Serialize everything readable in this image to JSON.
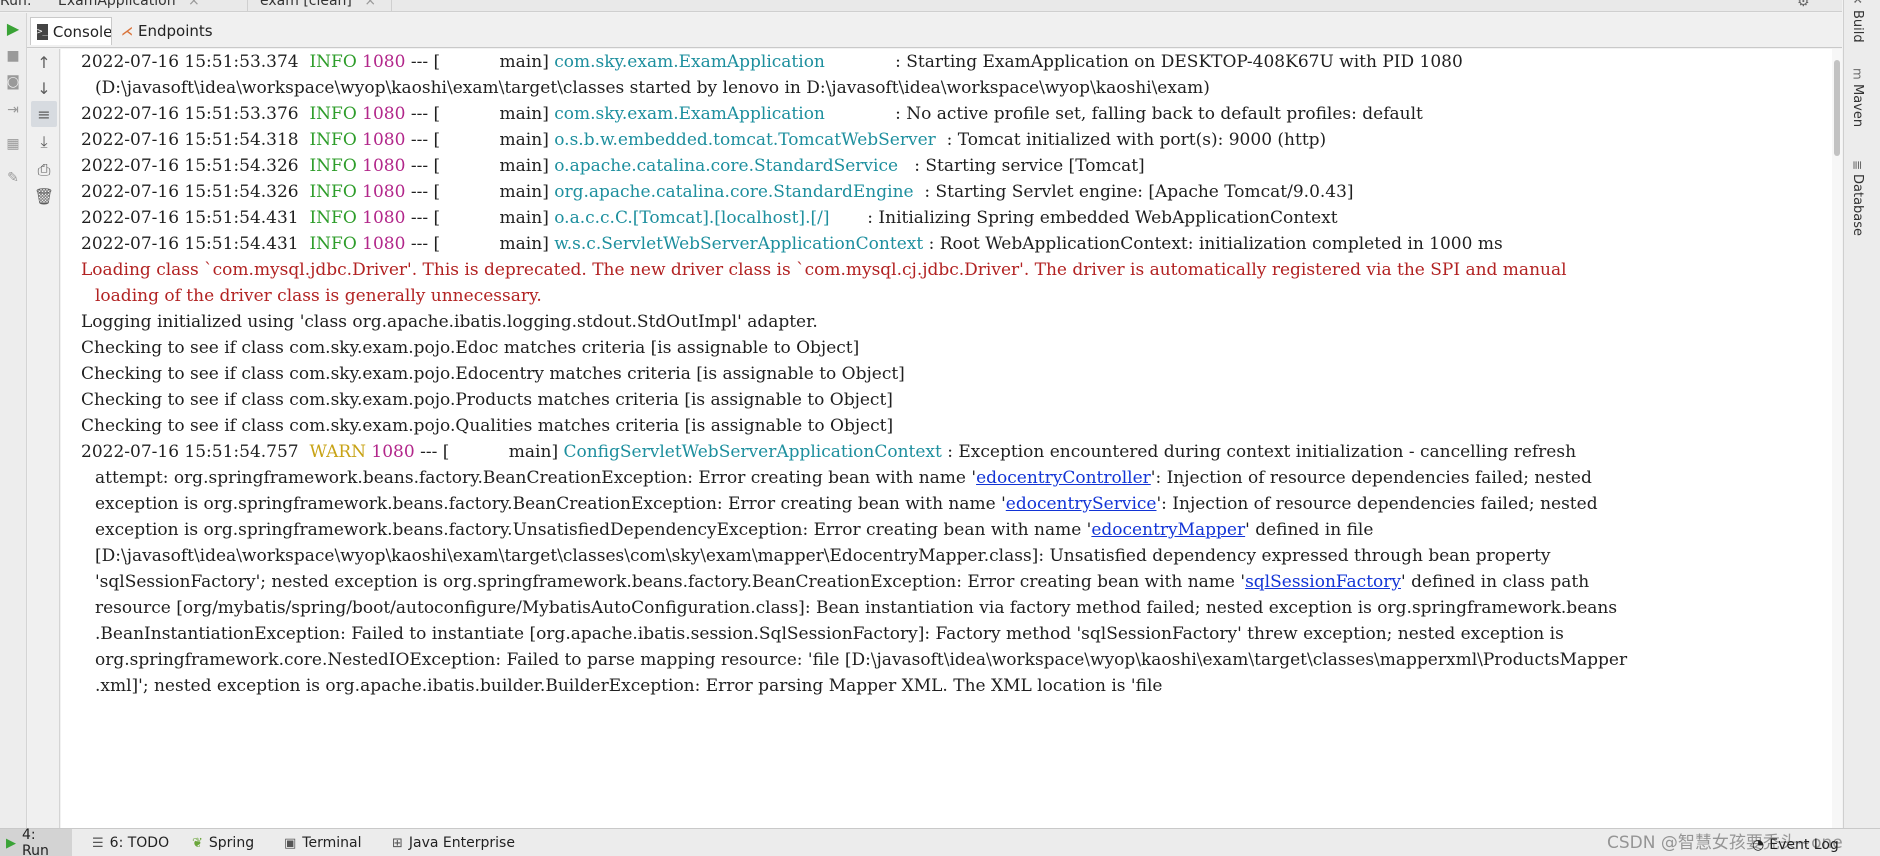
{
  "tool_window": {
    "run_label": "Run:",
    "tabs": [
      {
        "label": "ExamApplication"
      },
      {
        "label": "exam [clean]"
      }
    ],
    "close_glyph": "×"
  },
  "console_tabs": [
    {
      "label": "Console",
      "icon": "console-icon"
    },
    {
      "label": "Endpoints",
      "icon": "endpoints-icon"
    }
  ],
  "log": {
    "lines": [
      {
        "ts": "2022-07-16 15:51:53.374",
        "level": "INFO",
        "pid": "1080",
        "sep": " --- [           main] ",
        "logger": "com.sky.exam.ExamApplication            ",
        "msg": " : Starting ExamApplication on DESKTOP-408K67U with PID 1080"
      },
      {
        "cont": "(D:\\javasoft\\idea\\workspace\\wyop\\kaoshi\\exam\\target\\classes started by lenovo in D:\\javasoft\\idea\\workspace\\wyop\\kaoshi\\exam)"
      },
      {
        "ts": "2022-07-16 15:51:53.376",
        "level": "INFO",
        "pid": "1080",
        "sep": " --- [           main] ",
        "logger": "com.sky.exam.ExamApplication            ",
        "msg": " : No active profile set, falling back to default profiles: default"
      },
      {
        "ts": "2022-07-16 15:51:54.318",
        "level": "INFO",
        "pid": "1080",
        "sep": " --- [           main] ",
        "logger": "o.s.b.w.embedded.tomcat.TomcatWebServer ",
        "msg": " : Tomcat initialized with port(s): 9000 (http)"
      },
      {
        "ts": "2022-07-16 15:51:54.326",
        "level": "INFO",
        "pid": "1080",
        "sep": " --- [           main] ",
        "logger": "o.apache.catalina.core.StandardService  ",
        "msg": " : Starting service [Tomcat]"
      },
      {
        "ts": "2022-07-16 15:51:54.326",
        "level": "INFO",
        "pid": "1080",
        "sep": " --- [           main] ",
        "logger": "org.apache.catalina.core.StandardEngine ",
        "msg": " : Starting Servlet engine: [Apache Tomcat/9.0.43]"
      },
      {
        "ts": "2022-07-16 15:51:54.431",
        "level": "INFO",
        "pid": "1080",
        "sep": " --- [           main] ",
        "logger": "o.a.c.c.C.[Tomcat].[localhost].[/]      ",
        "msg": " : Initializing Spring embedded WebApplicationContext"
      },
      {
        "ts": "2022-07-16 15:51:54.431",
        "level": "INFO",
        "pid": "1080",
        "sep": " --- [           main] ",
        "logger": "w.s.c.ServletWebServerApplicationContext",
        "msg": " : Root WebApplicationContext: initialization completed in 1000 ms"
      }
    ],
    "deprecation": [
      "Loading class `com.mysql.jdbc.Driver'. This is deprecated. The new driver class is `com.mysql.cj.jdbc.Driver'. The driver is automatically registered via the SPI and manual",
      "loading of the driver class is generally unnecessary."
    ],
    "plain": [
      "Logging initialized using 'class org.apache.ibatis.logging.stdout.StdOutImpl' adapter.",
      "Checking to see if class com.sky.exam.pojo.Edoc matches criteria [is assignable to Object]",
      "Checking to see if class com.sky.exam.pojo.Edocentry matches criteria [is assignable to Object]",
      "Checking to see if class com.sky.exam.pojo.Products matches criteria [is assignable to Object]",
      "Checking to see if class com.sky.exam.pojo.Qualities matches criteria [is assignable to Object]"
    ],
    "warn": {
      "ts": "2022-07-16 15:51:54.757",
      "level": "WARN",
      "pid": "1080",
      "sep": " --- [           main] ",
      "logger": "ConfigServletWebServerApplicationContext",
      "msg": " : Exception encountered during context initialization - cancelling refresh",
      "cont": [
        {
          "pre": "attempt: org.springframework.beans.factory.BeanCreationException: Error creating bean with name '",
          "link": "edocentryController",
          "post": "': Injection of resource dependencies failed; nested"
        },
        {
          "pre": "exception is org.springframework.beans.factory.BeanCreationException: Error creating bean with name '",
          "link": "edocentryService",
          "post": "': Injection of resource dependencies failed; nested"
        },
        {
          "pre": "exception is org.springframework.beans.factory.UnsatisfiedDependencyException: Error creating bean with name '",
          "link": "edocentryMapper",
          "post": "' defined in file"
        },
        {
          "pre": "[D:\\javasoft\\idea\\workspace\\wyop\\kaoshi\\exam\\target\\classes\\com\\sky\\exam\\mapper\\EdocentryMapper.class]: Unsatisfied dependency expressed through bean property",
          "link": "",
          "post": ""
        },
        {
          "pre": "'sqlSessionFactory'; nested exception is org.springframework.beans.factory.BeanCreationException: Error creating bean with name '",
          "link": "sqlSessionFactory",
          "post": "' defined in class path"
        },
        {
          "pre": "resource [org/mybatis/spring/boot/autoconfigure/MybatisAutoConfiguration.class]: Bean instantiation via factory method failed; nested exception is org.springframework.beans",
          "link": "",
          "post": ""
        },
        {
          "pre": ".BeanInstantiationException: Failed to instantiate [org.apache.ibatis.session.SqlSessionFactory]: Factory method 'sqlSessionFactory' threw exception; nested exception is",
          "link": "",
          "post": ""
        },
        {
          "pre": "org.springframework.core.NestedIOException: Failed to parse mapping resource: 'file [D:\\javasoft\\idea\\workspace\\wyop\\kaoshi\\exam\\target\\classes\\mapperxml\\ProductsMapper",
          "link": "",
          "post": ""
        },
        {
          "pre": ".xml]'; nested exception is org.apache.ibatis.builder.BuilderException: Error parsing Mapper XML. The XML location is 'file",
          "link": "",
          "post": ""
        }
      ]
    }
  },
  "right_sidebar": [
    {
      "label": "Build",
      "icon": "hammer-icon"
    },
    {
      "label": "Maven",
      "icon": "maven-icon"
    },
    {
      "label": "Database",
      "icon": "database-icon"
    }
  ],
  "bottom_bar": {
    "items": [
      {
        "label": "4: Run",
        "icon": "run-icon"
      },
      {
        "label": "6: TODO",
        "icon": "todo-icon"
      },
      {
        "label": "Spring",
        "icon": "spring-icon"
      },
      {
        "label": "Terminal",
        "icon": "terminal-icon"
      },
      {
        "label": "Java Enterprise",
        "icon": "java-enterprise-icon"
      }
    ],
    "watermark": "CSDN @智慧女孩要秃头~one",
    "event_log": "Event Log"
  },
  "colors": {
    "info": "#2e9d2a",
    "warn": "#c8a316",
    "pid": "#b2268a",
    "logger": "#1d8f9e",
    "error_text": "#b22222",
    "link": "#1234d6"
  }
}
